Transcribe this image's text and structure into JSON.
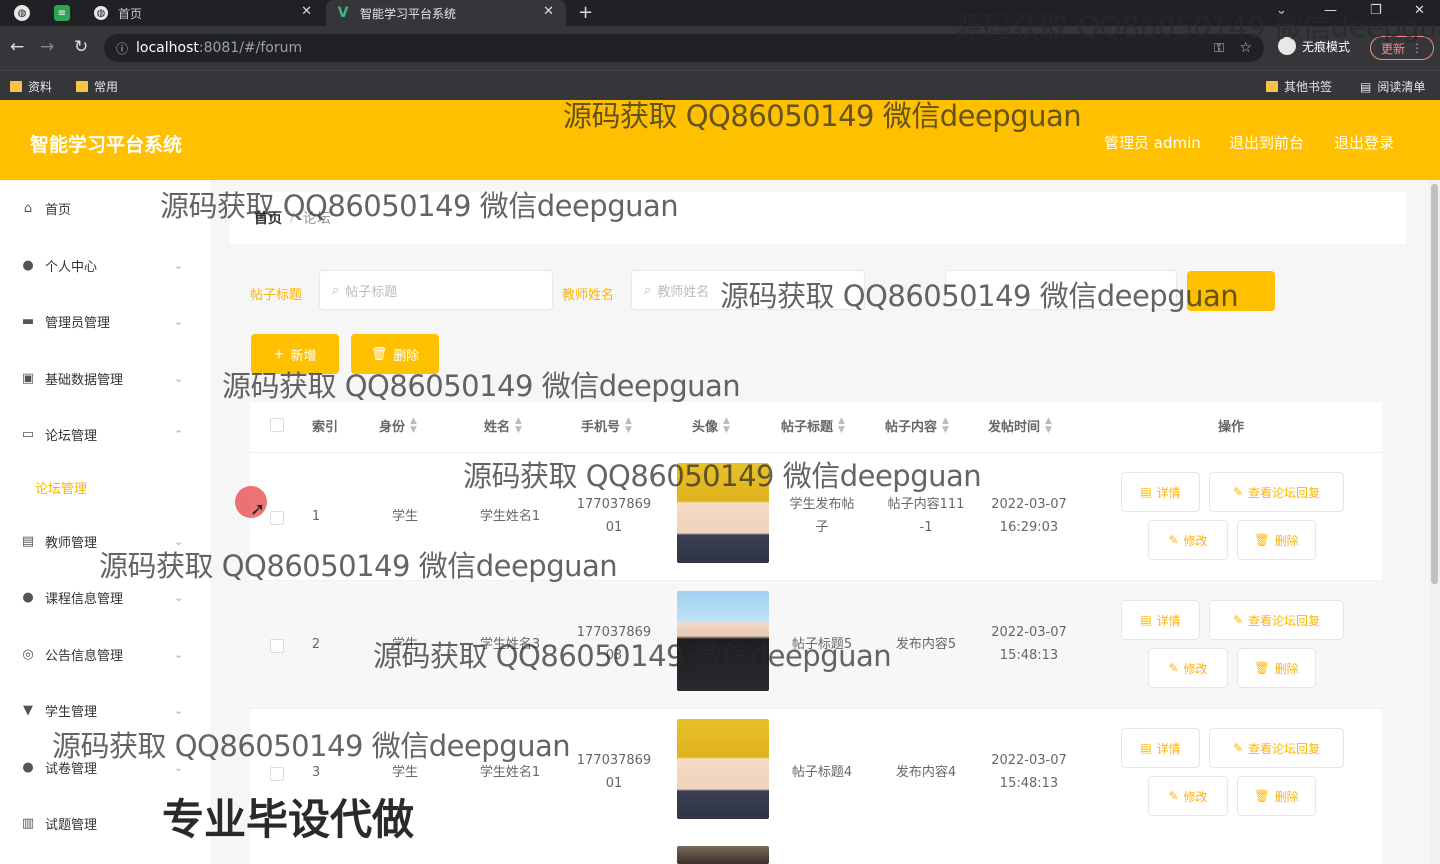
{
  "browser": {
    "tabs": [
      {
        "label": "首页",
        "active": false
      },
      {
        "label": "智能学习平台系统",
        "active": true
      }
    ],
    "url_host": "localhost",
    "url_rest": ":8081/#/forum",
    "incognito_label": "无痕模式",
    "update_label": "更新",
    "bookmarks": [
      "资料",
      "常用"
    ],
    "bookmarks_right": [
      "其他书签",
      "阅读清单"
    ]
  },
  "header": {
    "title": "智能学习平台系统",
    "admin_label": "管理员 admin",
    "to_front_label": "退出到前台",
    "logout_label": "退出登录"
  },
  "sidebar": {
    "items": [
      {
        "label": "首页",
        "icon": "home-icon"
      },
      {
        "label": "个人中心",
        "icon": "user-icon"
      },
      {
        "label": "管理员管理",
        "icon": "briefcase-icon"
      },
      {
        "label": "基础数据管理",
        "icon": "box-icon"
      },
      {
        "label": "论坛管理",
        "icon": "chat-icon"
      },
      {
        "label": "教师管理",
        "icon": "teacher-icon"
      },
      {
        "label": "课程信息管理",
        "icon": "user-icon"
      },
      {
        "label": "公告信息管理",
        "icon": "compass-icon"
      },
      {
        "label": "学生管理",
        "icon": "student-icon"
      },
      {
        "label": "试卷管理",
        "icon": "bulb-icon"
      },
      {
        "label": "试题管理",
        "icon": "chart-icon"
      }
    ],
    "active_submenu": "论坛管理"
  },
  "breadcrumb": {
    "home": "首页",
    "sep": "/",
    "current": "论坛"
  },
  "search": {
    "title_label": "帖子标题",
    "title_placeholder": "帖子标题",
    "teacher_label": "教师姓名",
    "teacher_placeholder": "教师姓名"
  },
  "actions": {
    "add_label": "新增",
    "delete_label": "删除"
  },
  "table": {
    "headers": [
      "索引",
      "身份",
      "姓名",
      "手机号",
      "头像",
      "帖子标题",
      "帖子内容",
      "发帖时间",
      "操作"
    ],
    "rows": [
      {
        "index": "1",
        "role": "学生",
        "name": "学生姓名1",
        "phone_a": "177037869",
        "phone_b": "01",
        "title_a": "学生发布帖",
        "title_b": "子",
        "content_a": "帖子内容111",
        "content_b": "-1",
        "date": "2022-03-07",
        "time": "16:29:03"
      },
      {
        "index": "2",
        "role": "学生",
        "name": "学生姓名3",
        "phone_a": "177037869",
        "phone_b": "03",
        "title_a": "帖子标题5",
        "title_b": "",
        "content_a": "发布内容5",
        "content_b": "",
        "date": "2022-03-07",
        "time": "15:48:13"
      },
      {
        "index": "3",
        "role": "学生",
        "name": "学生姓名1",
        "phone_a": "177037869",
        "phone_b": "01",
        "title_a": "帖子标题4",
        "title_b": "",
        "content_a": "发布内容4",
        "content_b": "",
        "date": "2022-03-07",
        "time": "15:48:13"
      }
    ],
    "ops": {
      "detail": "详情",
      "view_reply": "查看论坛回复",
      "edit": "修改",
      "delete": "删除"
    }
  },
  "overlays": {
    "watermark": "源码获取 QQ86050149 微信deepguan",
    "banner": "专业毕设代做"
  },
  "colors": {
    "accent": "#ffc000",
    "accent_text": "#ffb400"
  }
}
